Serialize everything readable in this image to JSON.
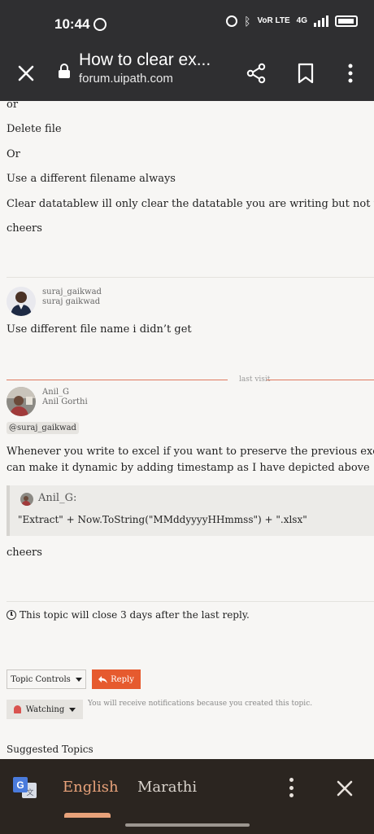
{
  "status_bar": {
    "time": "10:44",
    "network_label": "VoR LTE",
    "signal_label": "4G"
  },
  "app_bar": {
    "title": "How to clear ex...",
    "domain": "forum.uipath.com"
  },
  "post1": {
    "lines": [
      "or",
      "Delete file",
      "Or",
      "Use a different filename always",
      "Clear datatablew ill only clear the datatable you are writing but not the excel",
      "cheers"
    ]
  },
  "post2": {
    "username": "suraj_gaikwad",
    "fullname": "suraj gaikwad",
    "body": "Use different file name i didn’t get"
  },
  "last_visit_label": "last visit",
  "post3": {
    "username": "Anil_G",
    "fullname": "Anil Gorthi",
    "mention": "@suraj_gaikwad",
    "body_line1": "Whenever you write to excel if you want to preserve the previous excel as wel",
    "body_line2": "can make it dynamic by adding timestamp as I have depicted above",
    "quote_user": "Anil_G:",
    "quote_text": "\"Extract\" + Now.ToString(\"MMddyyyyHHmmss\") + \".xlsx\"",
    "closing": "cheers"
  },
  "topic_close_notice": "This topic will close 3 days after the last reply.",
  "controls": {
    "topic_controls": "Topic Controls",
    "reply": "Reply",
    "watching": "Watching",
    "watching_note": "You will receive notifications because you created this topic."
  },
  "suggested_topics": "Suggested Topics",
  "translate_bar": {
    "source_lang": "English",
    "target_lang": "Marathi"
  },
  "colors": {
    "accent": "#e65a2e",
    "bar": "#2f2f31",
    "translate_bg": "#2b2520",
    "highlight": "#e8a27a"
  }
}
